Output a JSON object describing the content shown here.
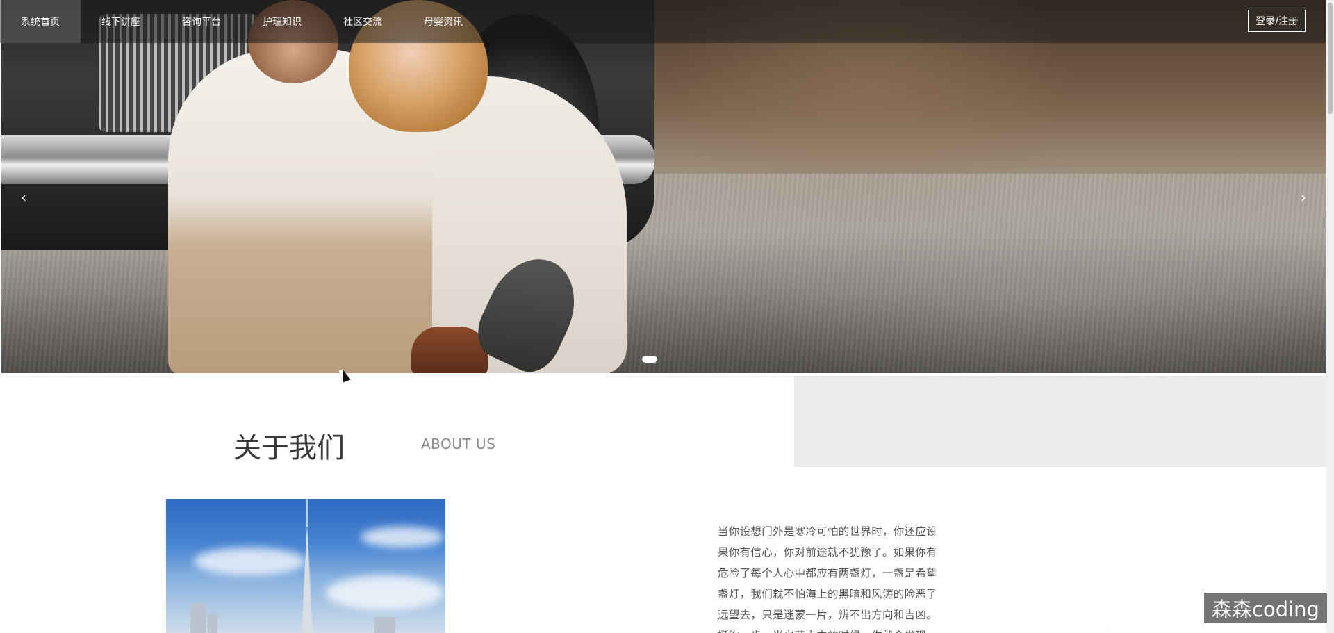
{
  "nav": {
    "items": [
      {
        "label": "系统首页",
        "active": true
      },
      {
        "label": "线下讲座",
        "active": false
      },
      {
        "label": "咨询平台",
        "active": false
      },
      {
        "label": "护理知识",
        "active": false
      },
      {
        "label": "社区交流",
        "active": false
      },
      {
        "label": "母婴资讯",
        "active": false
      }
    ],
    "login_label": "登录/注册"
  },
  "carousel": {
    "prev_label": "‹",
    "next_label": "›",
    "slide_count": 1,
    "active_slide": 1
  },
  "about": {
    "title": "关于我们",
    "subtitle": "ABOUT US",
    "paragraph_lines": [
      "当你设想门外是寒冷可怕的世界时，你还应设",
      "果你有信心，你对前途就不犹豫了。如果你有",
      "危险了每个人心中都应有两盏灯，一盏是希望",
      "盏灯，我们就不怕海上的黑暗和风涛的险恶了",
      "远望去，只是迷蒙一片，辨不出方向和吉凶。",
      "挺胸一步，当自艾走中的时候，你就会发现"
    ]
  },
  "watermark": "森森coding",
  "colors": {
    "nav_bg": "#1c1c1c",
    "section_gray": "#ececec",
    "text": "#555555"
  }
}
